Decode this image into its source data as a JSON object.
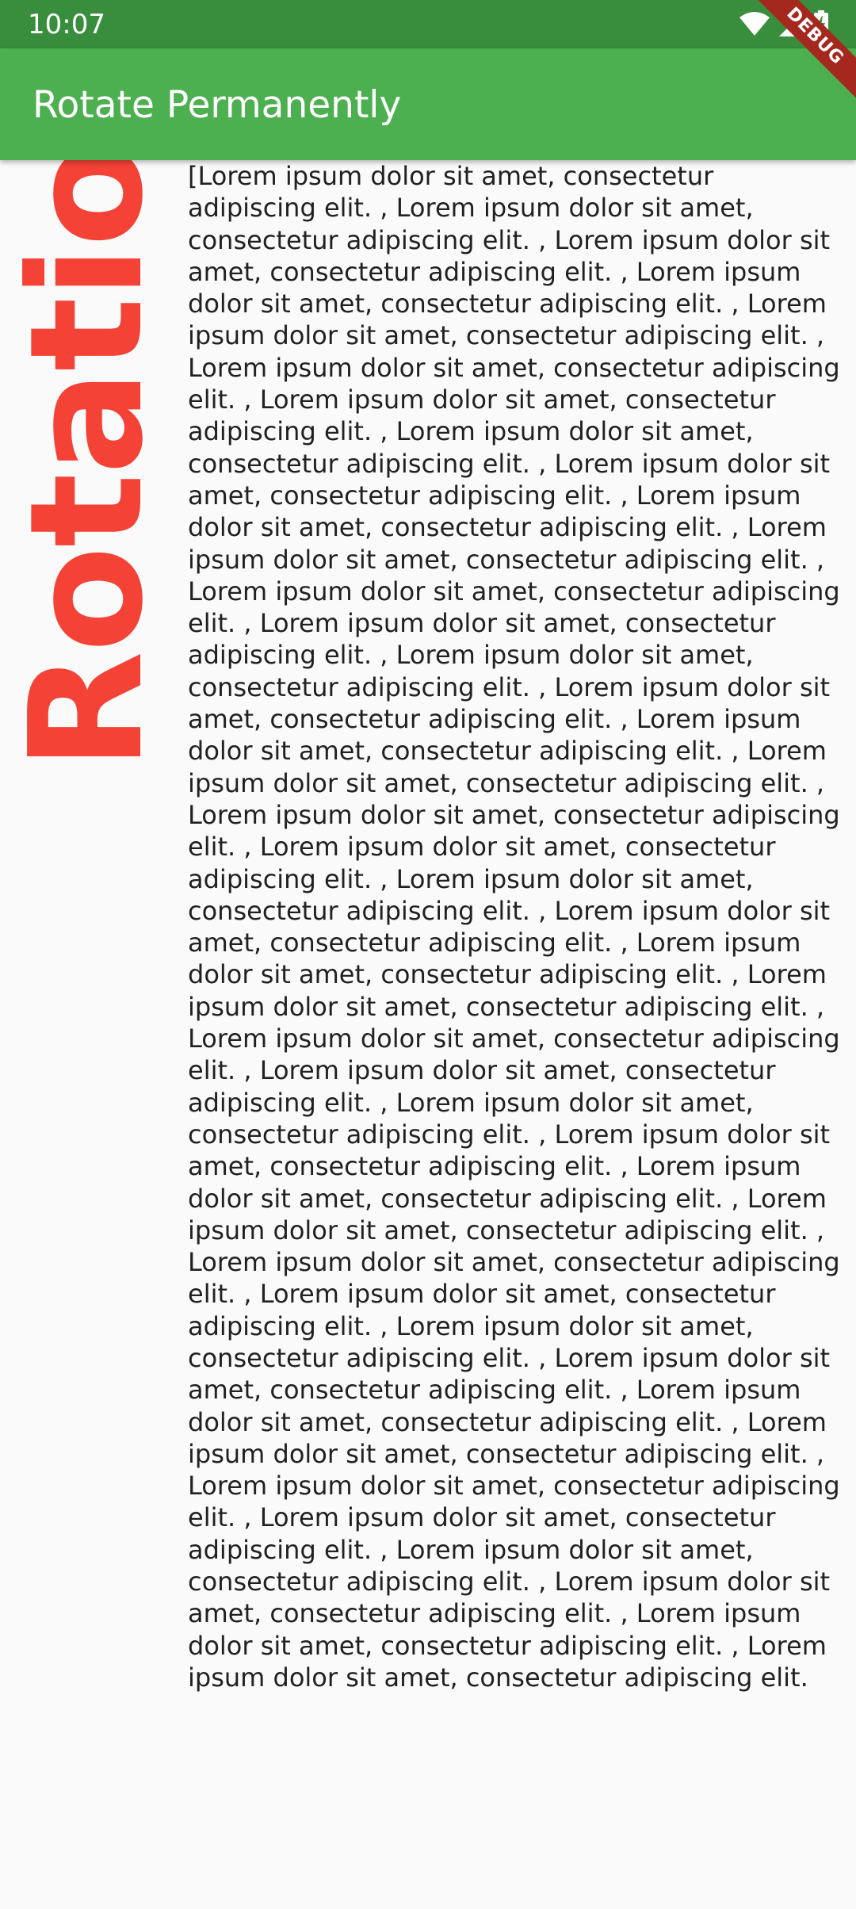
{
  "status_bar": {
    "time": "10:07",
    "icons": [
      "wifi-icon",
      "cell-signal-icon",
      "battery-charging-icon"
    ]
  },
  "app_bar": {
    "title": "Rotate Permanently"
  },
  "debug_banner": {
    "label": "DEBUG"
  },
  "content": {
    "rotated_label": "Rotation",
    "body_text": "[Lorem ipsum dolor sit amet, consectetur adipiscing elit. , Lorem ipsum dolor sit amet, consectetur adipiscing elit. , Lorem ipsum dolor sit amet, consectetur adipiscing elit. , Lorem ipsum dolor sit amet, consectetur adipiscing elit. , Lorem ipsum dolor sit amet, consectetur adipiscing elit. , Lorem ipsum dolor sit amet, consectetur adipiscing elit. , Lorem ipsum dolor sit amet, consectetur adipiscing elit. , Lorem ipsum dolor sit amet, consectetur adipiscing elit. , Lorem ipsum dolor sit amet, consectetur adipiscing elit. , Lorem ipsum dolor sit amet, consectetur adipiscing elit. , Lorem ipsum dolor sit amet, consectetur adipiscing elit. , Lorem ipsum dolor sit amet, consectetur adipiscing elit. , Lorem ipsum dolor sit amet, consectetur adipiscing elit. , Lorem ipsum dolor sit amet, consectetur adipiscing elit. , Lorem ipsum dolor sit amet, consectetur adipiscing elit. , Lorem ipsum dolor sit amet, consectetur adipiscing elit. , Lorem ipsum dolor sit amet, consectetur adipiscing elit. , Lorem ipsum dolor sit amet, consectetur adipiscing elit. , Lorem ipsum dolor sit amet, consectetur adipiscing elit. , Lorem ipsum dolor sit amet, consectetur adipiscing elit. , Lorem ipsum dolor sit amet, consectetur adipiscing elit. , Lorem ipsum dolor sit amet, consectetur adipiscing elit. , Lorem ipsum dolor sit amet, consectetur adipiscing elit. , Lorem ipsum dolor sit amet, consectetur adipiscing elit. , Lorem ipsum dolor sit amet, consectetur adipiscing elit. , Lorem ipsum dolor sit amet, consectetur adipiscing elit. , Lorem ipsum dolor sit amet, consectetur adipiscing elit. , Lorem ipsum dolor sit amet, consectetur adipiscing elit. , Lorem ipsum dolor sit amet, consectetur adipiscing elit. , Lorem ipsum dolor sit amet, consectetur adipiscing elit. , Lorem ipsum dolor sit amet, consectetur adipiscing elit. , Lorem ipsum dolor sit amet, consectetur adipiscing elit. , Lorem ipsum dolor sit amet, consectetur adipiscing elit. , Lorem ipsum dolor sit amet, consectetur adipiscing elit. , Lorem ipsum dolor sit amet, consectetur adipiscing elit. , Lorem ipsum dolor sit amet, consectetur adipiscing elit. , Lorem ipsum dolor sit amet, consectetur adipiscing elit. , Lorem ipsum dolor sit amet, consectetur adipiscing elit. , Lorem ipsum dolor sit amet, consectetur adipiscing elit. , Lorem ipsum dolor sit amet, consectetur adipiscing elit. , Lorem ipsum dolor sit amet, consectetur adipiscing elit."
  },
  "colors": {
    "status_bar": "#388e3c",
    "app_bar": "#4caf50",
    "rotated_label": "#f44336",
    "debug_banner": "#a5281f",
    "background": "#fafafa",
    "body_text": "#212121"
  }
}
